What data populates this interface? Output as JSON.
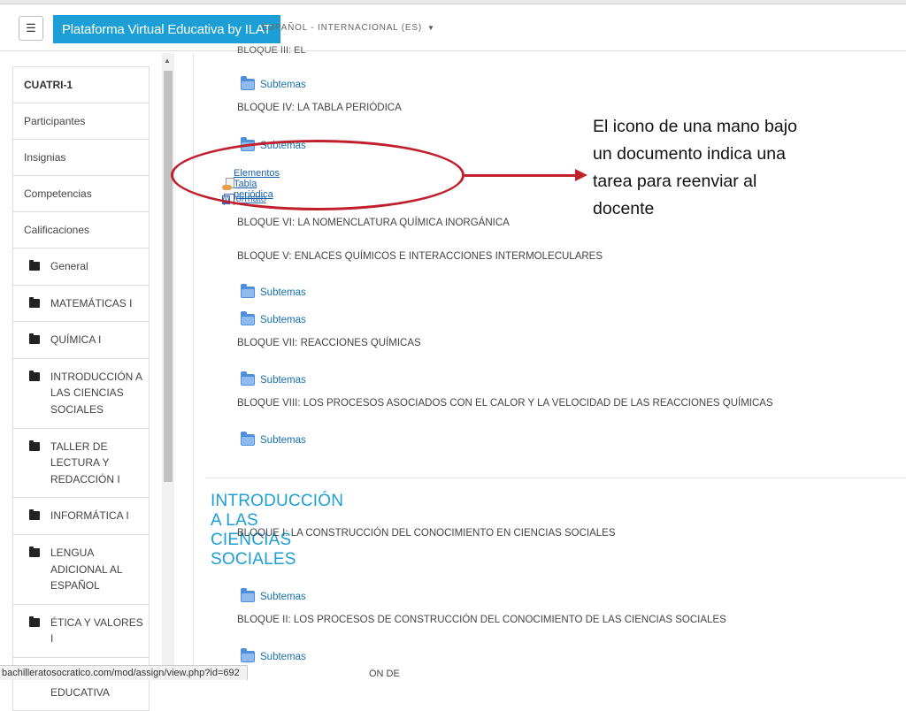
{
  "navbar": {
    "menu_icon": "☰",
    "brand": "Plataforma Virtual Educativa by ILAT",
    "language": "ESPAÑOL - INTERNACIONAL (ES)",
    "language_caret": "▼"
  },
  "sidebar": {
    "course": "CUATRI-1",
    "items": [
      "Participantes",
      "Insignias",
      "Competencias",
      "Calificaciones"
    ],
    "sections": [
      "General",
      "MATEMÁTICAS I",
      "QUÍMICA I",
      "INTRODUCCIÓN A LAS CIENCIAS SOCIALES",
      "TALLER DE LECTURA Y REDACCIÓN I",
      "INFORMÁTICA I",
      "LENGUA ADICIONAL AL ESPAÑOL",
      "ÉTICA Y VALORES I",
      "ORIENTACIÓN EDUCATIVA"
    ]
  },
  "content": {
    "clipped_heading": "BLOQUE III: EL MODELO ATÓMICO ACTUAL Y SUS APLICACIONES",
    "subtemas_label": "Subtemas",
    "bloque_iv": "BLOQUE IV: LA TABLA PERIÓDICA",
    "assignment_link": "Elementos Tabla periódica",
    "word_link": "Formato original para los elementos de la tabla periódica",
    "bloque_vi": "BLOQUE VI: LA NOMENCLATURA QUÍMICA INORGÁNICA",
    "bloque_v": "BLOQUE V: ENLACES QUÍMICOS E INTERACCIONES INTERMOLECULARES",
    "bloque_vii": "BLOQUE VII: REACCIONES QUÍMICAS",
    "bloque_viii": "BLOQUE VIII: LOS PROCESOS ASOCIADOS CON EL CALOR Y LA VELOCIDAD DE LAS REACCIONES QUÍMICAS",
    "section_title": "INTRODUCCIÓN A LAS CIENCIAS SOCIALES",
    "bloque_i": "BLOQUE I: LA CONSTRUCCIÓN DEL CONOCIMIENTO EN CIENCIAS SOCIALES",
    "bloque_ii": "BLOQUE II: LOS PROCESOS DE  CONSTRUCCIÓN DEL CONOCIMIENTO DE LAS  CIENCIAS SOCIALES",
    "bloque_iii_clipped": "ÓN DE LAS CIENCIAS SOCIALES"
  },
  "annotation": {
    "text": "El icono de una mano bajo un documento indica una tarea para reenviar al docente",
    "color": "#c0202b"
  },
  "statusbar": {
    "url": "bachilleratosocratico.com/mod/assign/view.php?id=692"
  },
  "colors": {
    "brand": "#1c9fd6",
    "link": "#1a6fae",
    "highlight": "#c0202b"
  }
}
